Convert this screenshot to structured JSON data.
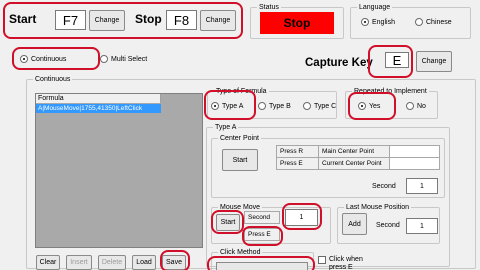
{
  "hotkeys": {
    "start_label": "Start",
    "start_key": "F7",
    "stop_label": "Stop",
    "stop_key": "F8",
    "change_label": "Change"
  },
  "status": {
    "legend": "Status",
    "value": "Stop",
    "color": "#ff0000"
  },
  "language": {
    "legend": "Language",
    "options": [
      {
        "label": "English",
        "selected": true
      },
      {
        "label": "Chinese",
        "selected": false
      }
    ]
  },
  "mode": {
    "options": [
      {
        "label": "Continuous",
        "selected": true
      },
      {
        "label": "Multi Select",
        "selected": false
      }
    ]
  },
  "capture": {
    "label": "Capture Key",
    "key": "E",
    "change_label": "Change"
  },
  "continuous": {
    "legend": "Continuous",
    "list_header": "Formula",
    "list_items": [
      "A|MouseMove|1755,41350|LeftClick"
    ],
    "buttons": [
      "Clear",
      "Insert",
      "Delete",
      "Load",
      "Save"
    ]
  },
  "formula_type": {
    "legend": "Type of Formula",
    "options": [
      {
        "label": "Type A",
        "selected": true
      },
      {
        "label": "Type B",
        "selected": false
      },
      {
        "label": "Type C",
        "selected": false
      }
    ]
  },
  "repeat": {
    "legend": "Repeated to Implement",
    "options": [
      {
        "label": "Yes",
        "selected": true
      },
      {
        "label": "No",
        "selected": false
      }
    ]
  },
  "type_a": {
    "legend": "Type A",
    "center_point": {
      "legend": "Center Point",
      "start_label": "Start",
      "rows": [
        [
          "Press R",
          "Main Center Point",
          ""
        ],
        [
          "Press E",
          "Current Center Point",
          ""
        ]
      ],
      "second_label": "Second",
      "second_value": "1"
    },
    "mouse_move": {
      "legend": "Mouse Move",
      "start_label": "Start",
      "second_label": "Second",
      "second_value": "1",
      "press_label": "Press E"
    },
    "last_mouse": {
      "legend": "Last Mouse Position",
      "add_label": "Add",
      "second_label": "Second",
      "second_value": "1"
    },
    "click_method": {
      "legend": "Click Method",
      "option_label": "Click when press E"
    }
  }
}
